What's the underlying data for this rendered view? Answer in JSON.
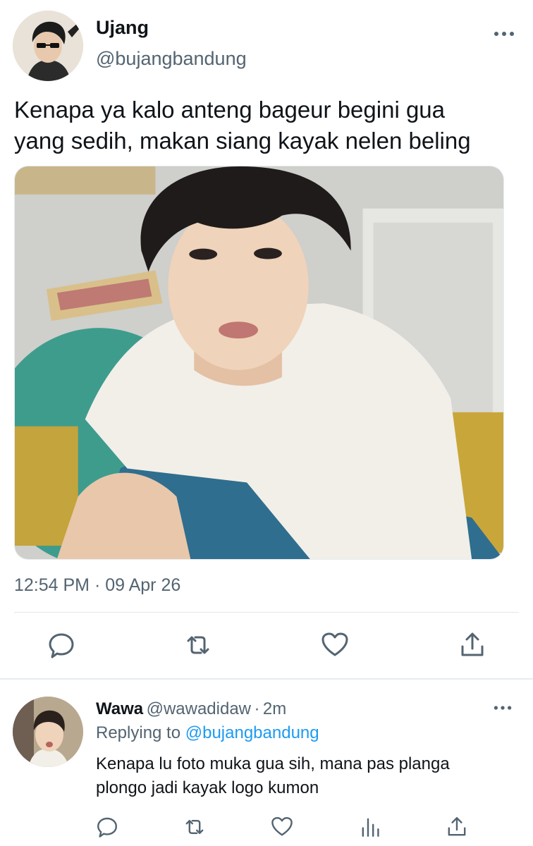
{
  "tweet": {
    "author_name": "Ujang",
    "author_handle": "@bujangbandung",
    "text": "Kenapa ya kalo anteng bageur begini gua\nyang sedih, makan siang kayak nelen beling",
    "timestamp": "12:54 PM · 09 Apr 26",
    "actions": [
      "reply-icon",
      "retweet-icon",
      "like-icon",
      "share-icon"
    ]
  },
  "reply": {
    "author_name": "Wawa",
    "author_handle": "@wawadidaw",
    "time_sep": "·",
    "time": "2m",
    "replying_label": "Replying to",
    "replying_mention": "@bujangbandung",
    "text": "Kenapa lu foto muka gua sih, mana pas planga\nplongo jadi kayak logo kumon",
    "actions": [
      "reply-icon",
      "retweet-icon",
      "like-icon",
      "analytics-icon",
      "share-icon"
    ]
  },
  "colors": {
    "text": "#0f1419",
    "secondary": "#536471",
    "link": "#1d9bf0",
    "divider": "#e1e8ed"
  }
}
